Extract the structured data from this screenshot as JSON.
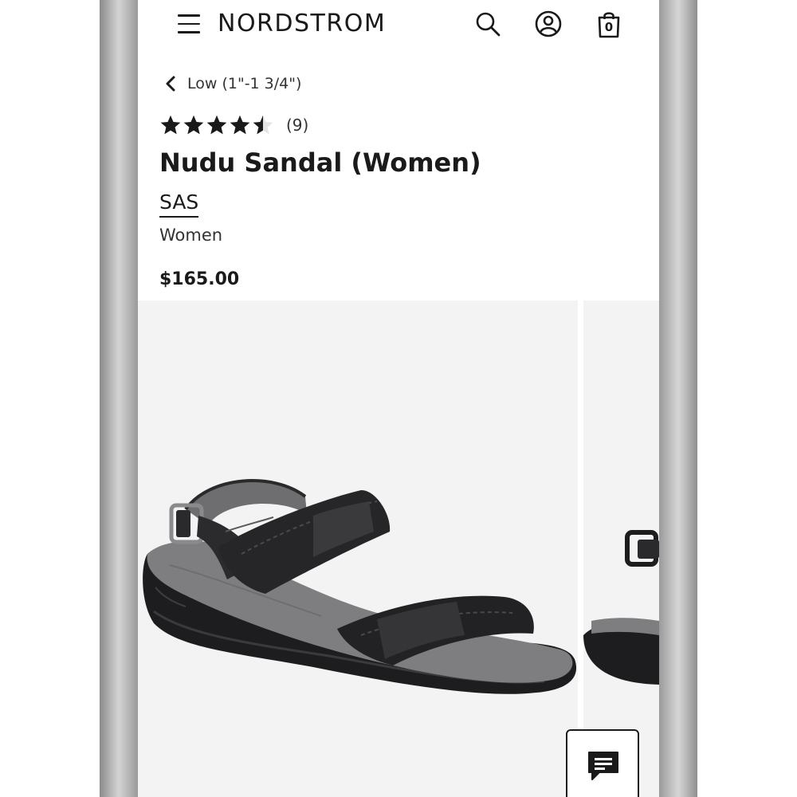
{
  "header": {
    "logo_text": "NORDSTROM",
    "bag_count": "0",
    "icons": [
      "menu-icon",
      "search-icon",
      "account-icon",
      "shopping-bag-icon"
    ]
  },
  "breadcrumb": {
    "label": "Low (1\"-1 3/4\")"
  },
  "product": {
    "rating": 4.5,
    "rating_max": 5,
    "review_count": "(9)",
    "title": "Nudu Sandal (Women)",
    "brand": "SAS",
    "category": "Women",
    "price": "$165.00"
  },
  "gallery": {
    "images": [
      "black-leather-sandal-angle",
      "black-leather-sandal-side"
    ]
  },
  "colors": {
    "text": "#1a1a1a",
    "image_bg": "#f3f3f3",
    "star": "#1a1a1a"
  }
}
